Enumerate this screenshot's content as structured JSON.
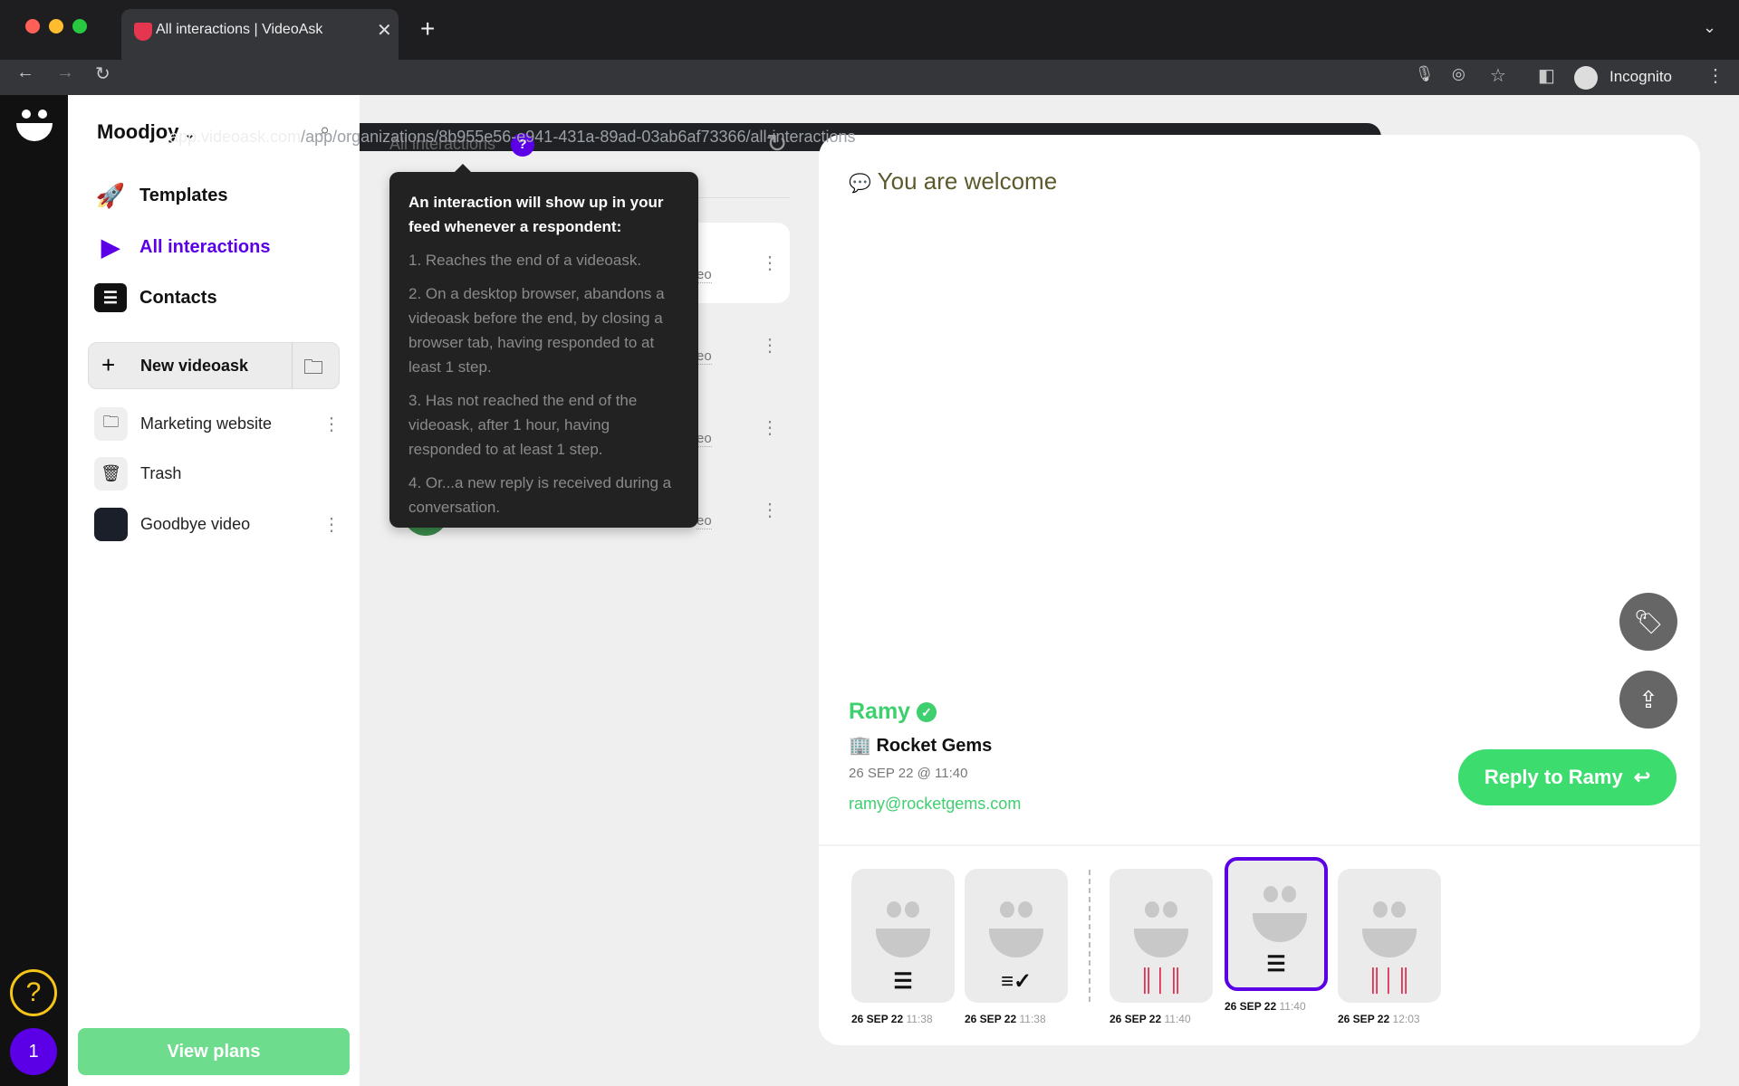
{
  "browser": {
    "tab_title": "All interactions | VideoAsk",
    "url_host": "app.videoask.com",
    "url_path": "/app/organizations/8b955e56-e941-431a-89ad-03ab6af73366/all-interactions",
    "profile": "Incognito"
  },
  "sidebar": {
    "org": "Moodjoy",
    "nav": [
      {
        "label": "Templates",
        "icon": "rocket-icon"
      },
      {
        "label": "All interactions",
        "icon": "play-chat-icon",
        "active": true
      },
      {
        "label": "Contacts",
        "icon": "contacts-icon"
      }
    ],
    "new_videoask": "New videoask",
    "items": [
      {
        "label": "Marketing website",
        "icon": "folder-icon"
      },
      {
        "label": "Trash",
        "icon": "trash-icon"
      },
      {
        "label": "Goodbye video",
        "icon": "video-thumbnail"
      }
    ],
    "view_plans": "View plans",
    "notification_count": "1",
    "accent": "#5b00e6"
  },
  "feed": {
    "title": "All interactions",
    "row_snippet": "eo",
    "tooltip": {
      "heading": "An interaction will show up in your feed whenever a respondent:",
      "items": [
        "1. Reaches the end of a videoask.",
        "2. On a desktop browser, abandons a videoask before the end, by closing a browser tab, having responded to at least 1 step.",
        "3. Has not reached the end of the videoask, after 1 hour, having responded to at least 1 step.",
        "4. Or...a new reply is received during a conversation."
      ]
    }
  },
  "detail": {
    "message": "You are welcome",
    "name": "Ramy",
    "company": "Rocket Gems",
    "date": "26 SEP 22 @ 11:40",
    "email": "ramy@rocketgems.com",
    "reply_label": "Reply to Ramy",
    "accent_green": "#3ecf6e",
    "steps": [
      {
        "date": "26 SEP 22",
        "time": "11:38",
        "type": "text"
      },
      {
        "date": "26 SEP 22",
        "time": "11:38",
        "type": "text-check"
      },
      {
        "date": "26 SEP 22",
        "time": "11:40",
        "type": "audio"
      },
      {
        "date": "26 SEP 22",
        "time": "11:40",
        "type": "text",
        "selected": true
      },
      {
        "date": "26 SEP 22",
        "time": "12:03",
        "type": "audio"
      }
    ]
  }
}
